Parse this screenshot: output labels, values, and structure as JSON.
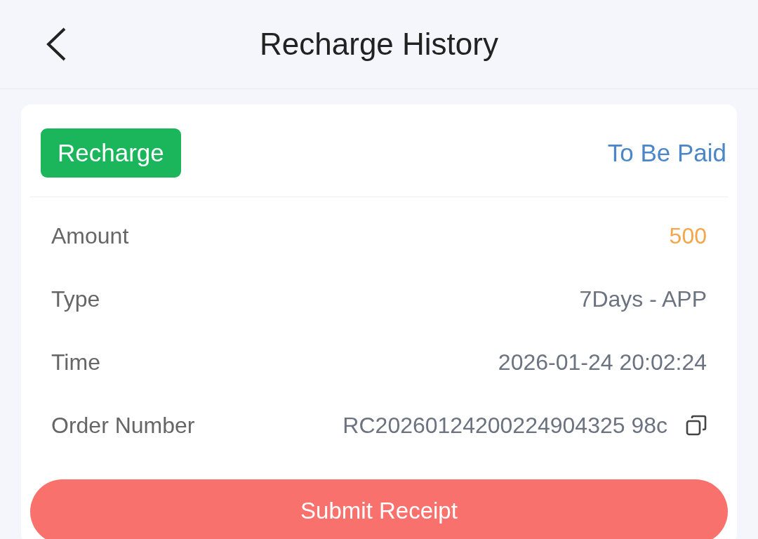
{
  "header": {
    "title": "Recharge History"
  },
  "card": {
    "badge": "Recharge",
    "status": "To Be Paid",
    "rows": [
      {
        "label": "Amount",
        "value": "500",
        "kind": "highlight"
      },
      {
        "label": "Type",
        "value": "7Days - APP",
        "kind": "plain"
      },
      {
        "label": "Time",
        "value": "2026-01-24 20:02:24",
        "kind": "plain"
      },
      {
        "label": "Order Number",
        "value": "RC20260124200224904325 98c",
        "kind": "copyable"
      }
    ]
  },
  "button": {
    "label": "Submit Receipt"
  }
}
